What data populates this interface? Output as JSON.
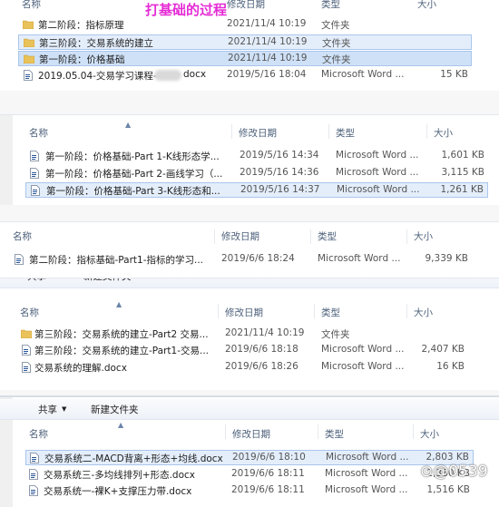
{
  "overlay_title": "打基础的过程",
  "watermark": "⊙@0539",
  "columns": {
    "name": "名称",
    "date": "修改日期",
    "type": "类型",
    "size": "大小"
  },
  "toolbar": {
    "share": "共享",
    "new_folder": "新建文件夹"
  },
  "panels": [
    {
      "rows": [
        {
          "icon": "folder",
          "name": "第二阶段：指标原理",
          "date": "2021/11/4 10:19",
          "type": "文件夹",
          "size": ""
        },
        {
          "icon": "folder",
          "name": "第三阶段：交易系统的建立",
          "date": "2021/11/4 10:19",
          "type": "文件夹",
          "size": ""
        },
        {
          "icon": "folder",
          "name": "第一阶段：价格基础",
          "date": "2021/11/4 10:19",
          "type": "文件夹",
          "size": ""
        },
        {
          "icon": "word",
          "name": "2019.05.04-交易学习课程-",
          "name_suffix": "docx",
          "date": "2019/5/16 18:04",
          "type": "Microsoft Word ...",
          "size": "15 KB"
        }
      ]
    },
    {
      "rows": [
        {
          "icon": "word",
          "name": "第一阶段：价格基础-Part 1-K线形态学...",
          "date": "2019/5/16 14:34",
          "type": "Microsoft Word ...",
          "size": "1,601 KB"
        },
        {
          "icon": "word",
          "name": "第一阶段：价格基础-Part 2-画线学习（...",
          "date": "2019/5/16 14:36",
          "type": "Microsoft Word ...",
          "size": "3,115 KB"
        },
        {
          "icon": "word",
          "name": "第一阶段：价格基础-Part 3-K线形态和...",
          "date": "2019/5/16 14:37",
          "type": "Microsoft Word ...",
          "size": "1,261 KB"
        }
      ]
    },
    {
      "rows": [
        {
          "icon": "word",
          "name": "第二阶段：指标基础-Part1-指标的学习...",
          "date": "2019/6/6 18:24",
          "type": "Microsoft Word ...",
          "size": "9,339 KB"
        }
      ]
    },
    {
      "rows": [
        {
          "icon": "folder",
          "name": "第三阶段：交易系统的建立-Part2 交易...",
          "date": "2021/11/4 10:19",
          "type": "文件夹",
          "size": ""
        },
        {
          "icon": "word",
          "name": "第三阶段：交易系统的建立-Part1-交易...",
          "date": "2019/6/6 18:18",
          "type": "Microsoft Word ...",
          "size": "2,407 KB"
        },
        {
          "icon": "word",
          "name": "交易系统的理解.docx",
          "date": "2019/6/6 18:26",
          "type": "Microsoft Word ...",
          "size": "16 KB"
        }
      ]
    },
    {
      "rows": [
        {
          "icon": "word",
          "name": "交易系统二-MACD背离+形态+均线.docx",
          "date": "2019/6/6 18:10",
          "type": "Microsoft Word ...",
          "size": "2,803 KB"
        },
        {
          "icon": "word",
          "name": "交易系统三-多均线排列+形态.docx",
          "date": "2019/6/6 18:11",
          "type": "Microsoft Word ...",
          "size": "2,380 KB"
        },
        {
          "icon": "word",
          "name": "交易系统一-裸K+支撑压力带.docx",
          "date": "2019/6/6 18:11",
          "type": "Microsoft Word ...",
          "size": "1,516 KB"
        }
      ]
    }
  ]
}
